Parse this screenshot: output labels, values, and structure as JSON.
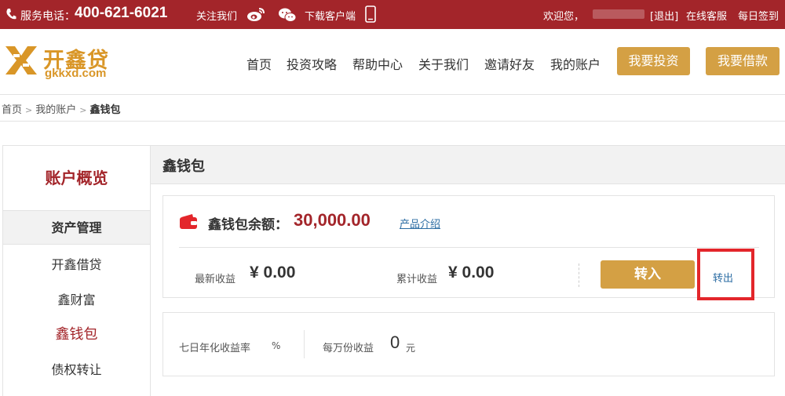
{
  "topbar": {
    "phone_label": "服务电话：",
    "phone_number": "400-621-6021",
    "follow_label": "关注我们",
    "download_label": "下载客户端",
    "welcome": "欢迎您，",
    "logout": "[退出]",
    "online_service": "在线客服",
    "checkin": "每日签到"
  },
  "header": {
    "logo_cn": "开鑫贷",
    "logo_en": "gkkxd.com",
    "nav": [
      "首页",
      "投资攻略",
      "帮助中心",
      "关于我们",
      "邀请好友",
      "我的账户"
    ],
    "invest_button": "我要投资",
    "borrow_button": "我要借款"
  },
  "breadcrumb": {
    "home": "首页",
    "account": "我的账户",
    "current": "鑫钱包",
    "sep": ">"
  },
  "sidebar": {
    "title": "账户概览",
    "section": "资产管理",
    "items": [
      "开鑫借贷",
      "鑫财富",
      "鑫钱包",
      "债权转让"
    ]
  },
  "main": {
    "title": "鑫钱包",
    "balance_label": "鑫钱包余额：",
    "balance_value": "30,000.00",
    "product_link": "产品介绍",
    "latest_label": "最新收益",
    "latest_value": "¥ 0.00",
    "total_label": "累计收益",
    "total_value": "¥ 0.00",
    "transfer_in": "转入",
    "transfer_out": "转出",
    "yield_label": "七日年化收益率",
    "yield_unit": "%",
    "per_label": "每万份收益",
    "per_value": "0",
    "per_unit": "元"
  },
  "colors": {
    "brand_red": "#a3252a",
    "gold": "#d4a044",
    "link_blue": "#2b6ca3",
    "highlight": "#e3262b"
  }
}
